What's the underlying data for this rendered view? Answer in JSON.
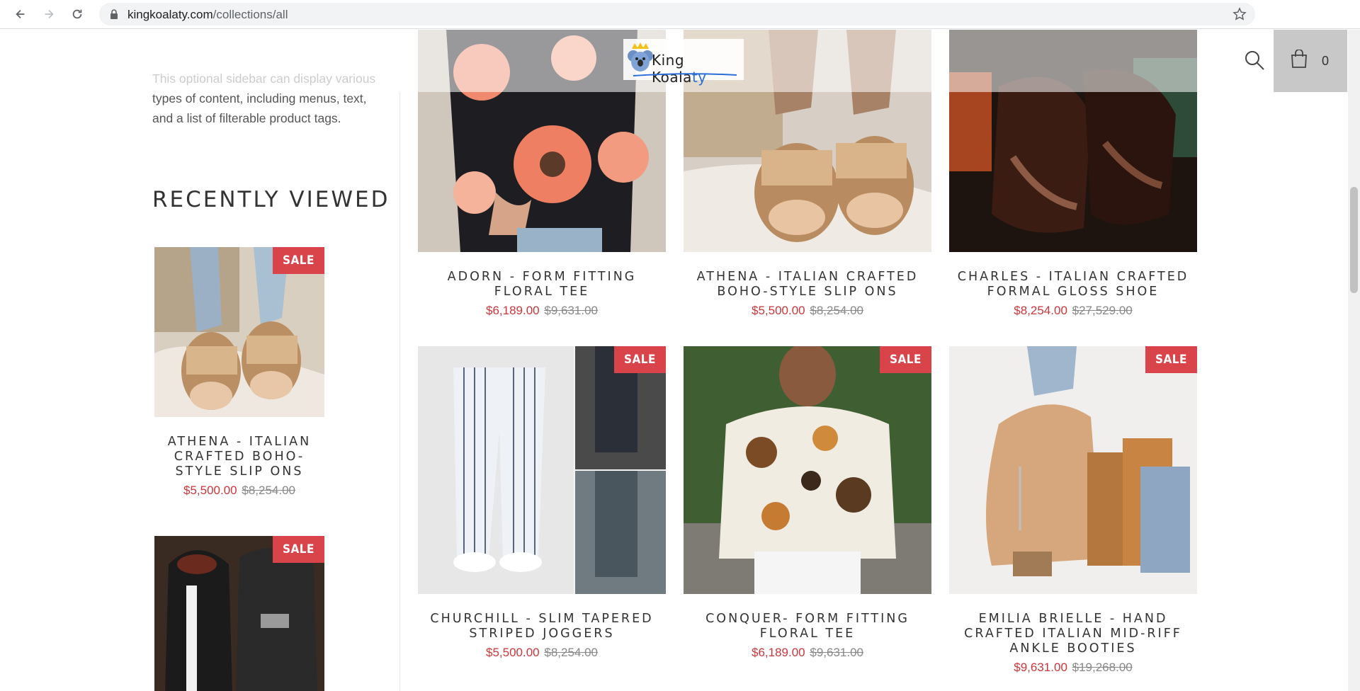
{
  "browser": {
    "url_domain": "kingkoalaty.com",
    "url_path": "/collections/all"
  },
  "header": {
    "logo_prefix": "K",
    "logo_text": "ing Koala",
    "logo_suffix": "ty",
    "cart_count": "0"
  },
  "sidebar": {
    "intro_faded": "This optional sidebar can display various",
    "intro_rest": "types of content, including menus, text, and a list of filterable product tags.",
    "recently_viewed_heading": "RECENTLY VIEWED",
    "items": [
      {
        "title": "ATHENA - ITALIAN CRAFTED BOHO-STYLE SLIP ONS",
        "price": "$5,500.00",
        "compare": "$8,254.00",
        "badge": "SALE"
      },
      {
        "badge": "SALE"
      }
    ]
  },
  "products": [
    {
      "title": "ADORN - FORM FITTING FLORAL TEE",
      "price": "$6,189.00",
      "compare": "$9,631.00"
    },
    {
      "title": "ATHENA - ITALIAN CRAFTED BOHO-STYLE SLIP ONS",
      "price": "$5,500.00",
      "compare": "$8,254.00"
    },
    {
      "title": "CHARLES - ITALIAN CRAFTED FORMAL GLOSS SHOE",
      "price": "$8,254.00",
      "compare": "$27,529.00"
    },
    {
      "title": "CHURCHILL - SLIM TAPERED STRIPED JOGGERS",
      "price": "$5,500.00",
      "compare": "$8,254.00",
      "badge": "SALE"
    },
    {
      "title": "CONQUER- FORM FITTING FLORAL TEE",
      "price": "$6,189.00",
      "compare": "$9,631.00",
      "badge": "SALE"
    },
    {
      "title": "EMILIA BRIELLE - HAND CRAFTED ITALIAN MID-RIFF ANKLE BOOTIES",
      "price": "$9,631.00",
      "compare": "$19,268.00",
      "badge": "SALE"
    }
  ],
  "colors": {
    "sale_badge": "#d9434a",
    "sale_price": "#c9363b",
    "cart_bg": "#c8c8c8"
  }
}
